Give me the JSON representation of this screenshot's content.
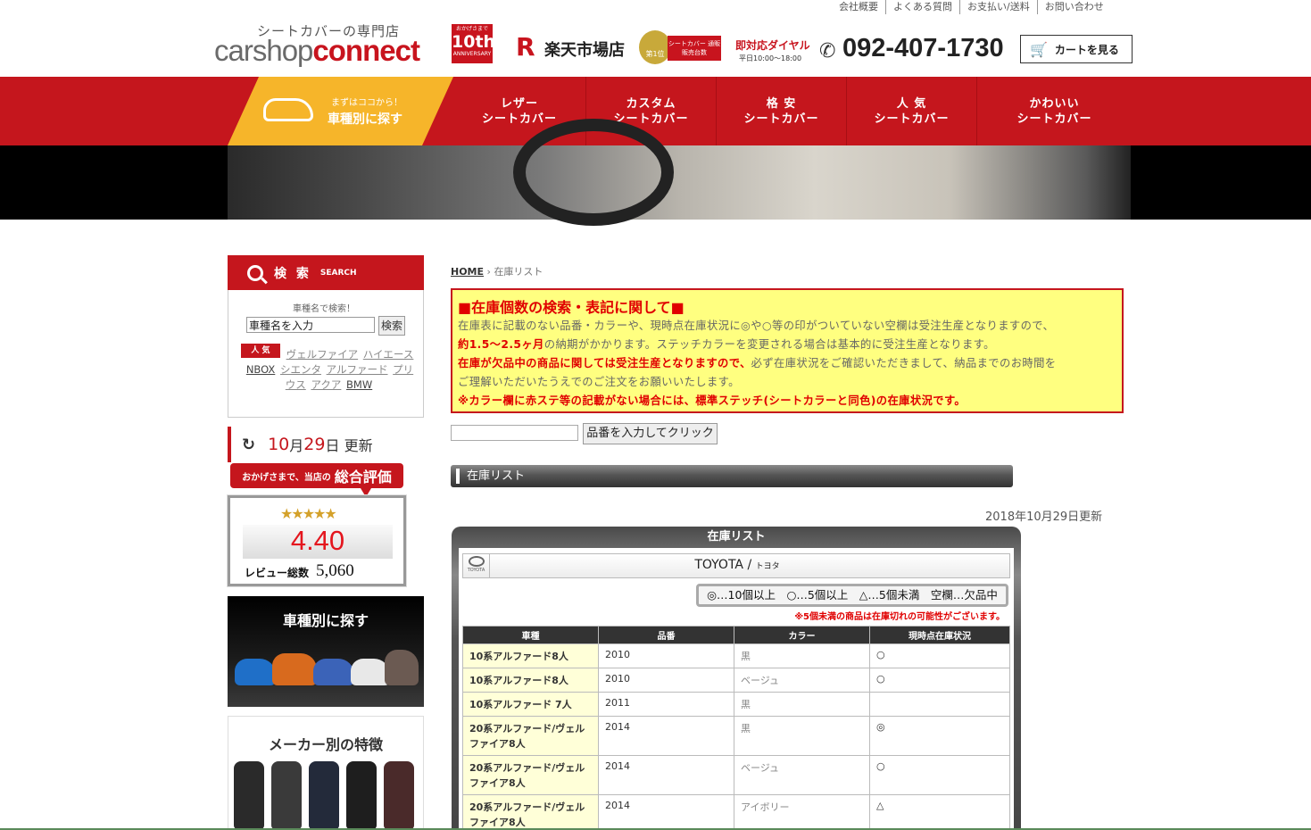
{
  "toplinks": [
    "会社概要",
    "よくある質問",
    "お支払い/送料",
    "お問い合わせ"
  ],
  "header": {
    "logo_sub": "シートカバーの専門店",
    "logo_main_a": "carshop",
    "logo_main_b": "connect",
    "badge_top": "おかげさまで",
    "badge_big": "10th",
    "badge_bottom": "ANNIVERSARY",
    "rakuten_mark": "R",
    "rakuten_label": "楽天市場店",
    "rank_medal": "第1位",
    "rank_ribbon": "シートカバー 通販販売台数",
    "dial_label": "即対応ダイヤル",
    "dial_hours": "平日10:00～18:00",
    "phone": "092-407-1730",
    "cart_label": "カートを見る"
  },
  "nav": {
    "search_small": "まずはココから！",
    "search_big": "車種別に探す",
    "items": [
      {
        "line1": "レザー",
        "line2": "シートカバー"
      },
      {
        "line1": "カスタム",
        "line2": "シートカバー"
      },
      {
        "line1": "格 安",
        "line2": "シートカバー"
      },
      {
        "line1": "人 気",
        "line2": "シートカバー"
      },
      {
        "line1": "かわいい",
        "line2": "シートカバー"
      }
    ]
  },
  "sidebar": {
    "search_title": "検 索",
    "search_en": "SEARCH",
    "search_hint": "車種名で検索！",
    "search_value": "車種名を入力",
    "search_button": "検索",
    "popular_tag": "人 気",
    "popular_links": [
      "ヴェルファイア",
      "ハイエース",
      "NBOX",
      "シエンタ",
      "アルファード",
      "プリウス",
      "アクア",
      "BMW"
    ],
    "update_month": "10",
    "update_month_unit": "月",
    "update_day": "29",
    "update_day_unit": "日 更新",
    "eval_pre": "おかげさまで、当店の",
    "eval_title": "総合評価",
    "eval_stars": "★★★★★",
    "eval_score": "4.40",
    "review_label": "レビュー総数",
    "review_count": "5,060",
    "bycar_title": "車種別に探す",
    "maker_title": "メーカー別の特徴"
  },
  "main": {
    "breadcrumb_home": "HOME",
    "breadcrumb_sep": "›",
    "breadcrumb_current": "在庫リスト",
    "notice_title": "■在庫個数の検索・表記に関して■",
    "notice_p1": "在庫表に記載のない品番・カラーや、現時点在庫状況に◎や○等の印がついていない空欄は受注生産となりますので、",
    "notice_p2_red": "約1.5～2.5ヶ月",
    "notice_p2": "の納期がかかります。ステッチカラーを変更される場合は基本的に受注生産となります。",
    "notice_p3_red": "在庫が欠品中の商品に関しては受注生産となりますので、",
    "notice_p3": "必ず在庫状況をご確認いただきまして、納品までのお時間を",
    "notice_p4": "ご理解いただいたうえでのご注文をお願いいたします。",
    "notice_p5_red": "※カラー欄に赤ステ等の記載がない場合には、標準ステッチ(シートカラーと同色)の在庫状況です。",
    "hinban_button": "品番を入力してクリック",
    "section_title": "在庫リスト",
    "updated": "2018年10月29日更新",
    "list_title": "在庫リスト",
    "maker_logo": "TOYOTA",
    "maker_name": "TOYOTA / ",
    "maker_kana": "トヨタ",
    "legend": "◎…10個以上　○…5個以上　△…5個未満　空欄…欠品中",
    "legend_note": "※5個未満の商品は在庫切れの可能性がございます。",
    "table_headers": [
      "車種",
      "品番",
      "カラー",
      "現時点在庫状況"
    ],
    "rows": [
      {
        "car": "10系アルファード8人",
        "code": "2010",
        "color": "黒",
        "stock": "○"
      },
      {
        "car": "10系アルファード8人",
        "code": "2010",
        "color": "ベージュ",
        "stock": "○"
      },
      {
        "car": "10系アルファード 7人",
        "code": "2011",
        "color": "黒",
        "stock": ""
      },
      {
        "car": "20系アルファード/ヴェルファイア8人",
        "code": "2014",
        "color": "黒",
        "stock": "◎"
      },
      {
        "car": "20系アルファード/ヴェルファイア8人",
        "code": "2014",
        "color": "ベージュ",
        "stock": "○"
      },
      {
        "car": "20系アルファード/ヴェルファイア8人",
        "code": "2014",
        "color": "アイボリー",
        "stock": "△"
      }
    ]
  }
}
